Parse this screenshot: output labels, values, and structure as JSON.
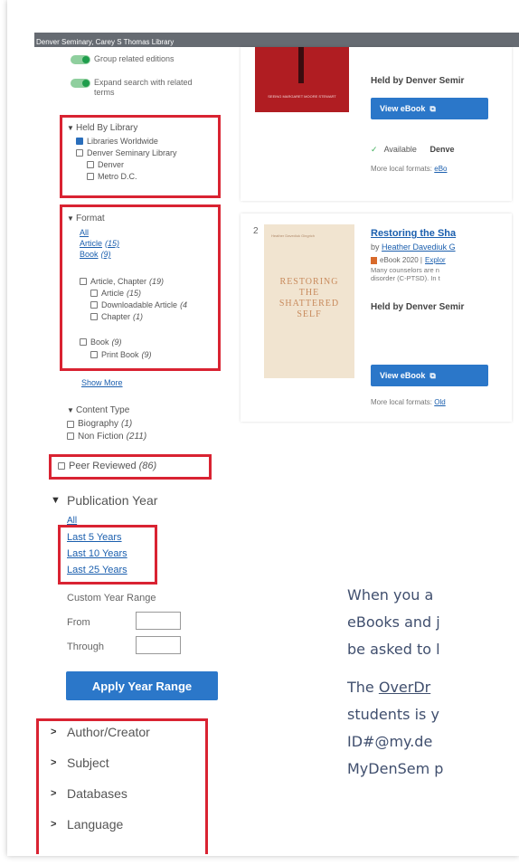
{
  "library_bar": {
    "title": "Denver Seminary, Carey S Thomas Library"
  },
  "toggles": [
    {
      "label": "Group related editions"
    },
    {
      "label_line1": "Expand search with related",
      "label_line2": "terms"
    }
  ],
  "held_by": {
    "heading": "Held By Library",
    "options": [
      {
        "label": "Libraries Worldwide",
        "checked": true
      },
      {
        "label": "Denver Seminary Library",
        "checked": false
      },
      {
        "label": "Denver",
        "checked": false
      },
      {
        "label": "Metro D.C.",
        "checked": false
      }
    ]
  },
  "format": {
    "heading": "Format",
    "links": [
      {
        "label": "All",
        "count": ""
      },
      {
        "label": "Article",
        "count": "(15)"
      },
      {
        "label": "Book",
        "count": "(9)"
      }
    ],
    "options": [
      {
        "label": "Article, Chapter",
        "count": "(19)"
      },
      {
        "label": "Article",
        "count": "(15)"
      },
      {
        "label": "Downloadable Article",
        "count": "(4"
      },
      {
        "label": "Chapter",
        "count": "(1)"
      },
      {
        "label": "Book",
        "count": "(9)"
      },
      {
        "label": "Print Book",
        "count": "(9)"
      }
    ],
    "show_more": "Show More"
  },
  "content_type": {
    "heading": "Content Type",
    "options": [
      {
        "label": "Biography",
        "count": "(1)"
      },
      {
        "label": "Non Fiction",
        "count": "(211)"
      },
      {
        "label": "Peer Reviewed",
        "count": "(86)"
      }
    ]
  },
  "publication_year": {
    "heading": "Publication Year",
    "links": [
      "All",
      "Last 5 Years",
      "Last 10 Years",
      "Last 25 Years"
    ],
    "custom_label": "Custom Year Range",
    "from_label": "From",
    "through_label": "Through",
    "from_value": "",
    "through_value": "",
    "apply_label": "Apply Year Range"
  },
  "collapsed_facets": [
    "Author/Creator",
    "Subject",
    "Databases",
    "Language"
  ],
  "results": {
    "result1": {
      "cover_text": "SEEING MARGARET MOORE STEWART",
      "held_by": "Held by Denver Semir",
      "view_label": "View eBook",
      "available": "Available",
      "available_loc": "Denve",
      "local_formats_label": "More local formats:",
      "local_formats_link": "eBo"
    },
    "result2": {
      "number": "2",
      "cover_title_lines": [
        "RESTORING",
        "THE",
        "SHATTERED",
        "SELF"
      ],
      "cover_author": "Heather Davediuk Gingrich",
      "title": "Restoring the Sha",
      "by_label": "by",
      "author": "Heather Davediuk G",
      "format_text": "eBook 2020 |",
      "format_link": "Explor",
      "description_line1": "Many counselors are n",
      "description_line2": "disorder (C-PTSD). In t",
      "held_by": "Held by Denver Semir",
      "view_label": "View eBook",
      "local_formats_label": "More local formats:",
      "local_formats_link": "Old"
    }
  },
  "doc_text": {
    "line1": "When you a",
    "line2": "eBooks and j",
    "line3": "be asked to l",
    "line4_pre": "The ",
    "line4_link": "OverDr",
    "line5": "students is y",
    "line6": "ID#@my.de",
    "line7": "MyDenSem p"
  }
}
